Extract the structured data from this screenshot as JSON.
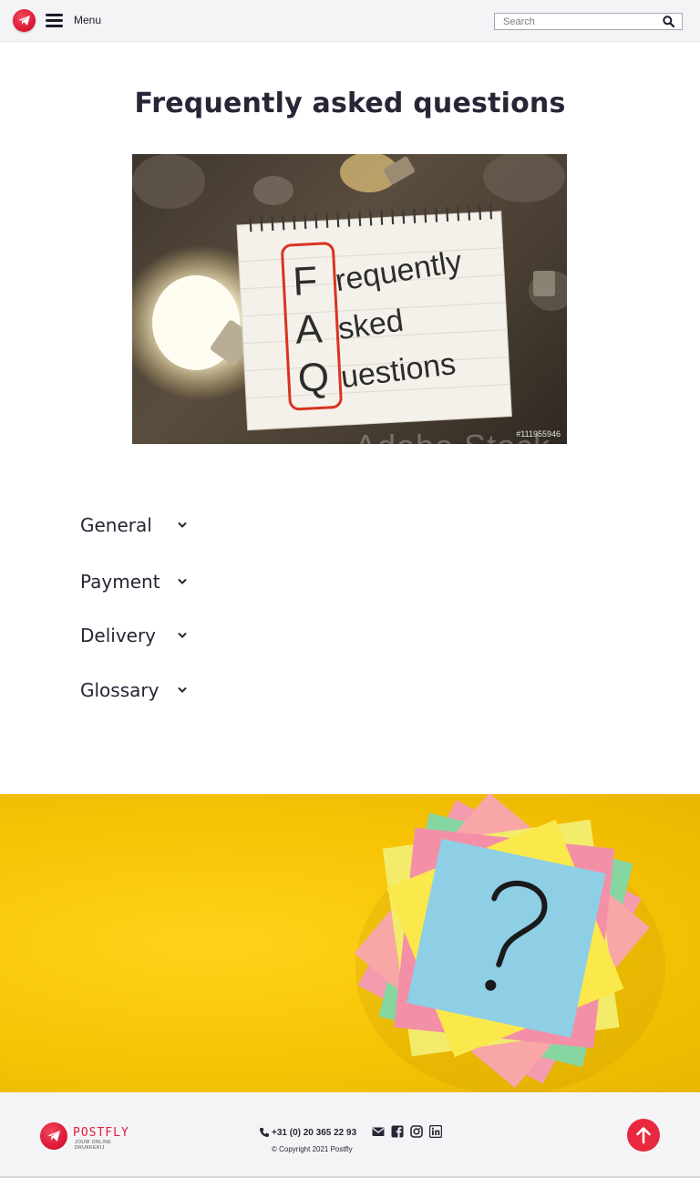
{
  "header": {
    "menu_label": "Menu",
    "search_placeholder": "Search"
  },
  "page": {
    "title": "Frequently asked questions"
  },
  "hero": {
    "watermark": "Adobe Stock",
    "stock_id": "#111955946",
    "note_letters": [
      "F",
      "A",
      "Q"
    ],
    "note_lines": [
      "requently",
      "sked",
      "uestions"
    ]
  },
  "accordion": {
    "items": [
      {
        "label": "General"
      },
      {
        "label": "Payment"
      },
      {
        "label": "Delivery"
      },
      {
        "label": "Glossary"
      }
    ]
  },
  "footer": {
    "logo_word": "POSTFLY",
    "logo_tagline": "JOUW ONLINE DRUKKERIJ",
    "phone": "+31 (0) 20 365 22 93",
    "copyright": "© Copyright 2021 Postfly",
    "social_icons": [
      "envelope-icon",
      "facebook-icon",
      "instagram-icon",
      "linkedin-icon"
    ]
  },
  "colors": {
    "brand_red": "#e21d3b",
    "banner_yellow": "#f7c405",
    "text_dark": "#262636"
  }
}
